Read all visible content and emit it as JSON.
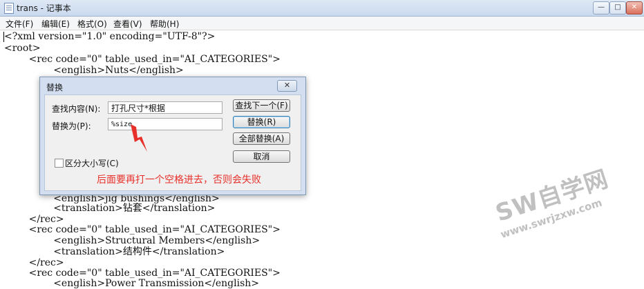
{
  "window": {
    "title": "trans - 记事本",
    "min_glyph": "—",
    "max_glyph": "□",
    "close_glyph": "✕"
  },
  "menu": [
    {
      "label": "文件(F)"
    },
    {
      "label": "编辑(E)"
    },
    {
      "label": "格式(O)"
    },
    {
      "label": "查看(V)"
    },
    {
      "label": "帮助(H)"
    }
  ],
  "editor": {
    "lines": [
      "<?xml version=\"1.0\" encoding=\"UTF-8\"?>",
      "<root>",
      "        <rec code=\"0\" table_used_in=\"AI_CATEGORIES\">",
      "                <english>Nuts</english>",
      "                <english>jig bushings</english>",
      "                <translation>钻套</translation>",
      "        </rec>",
      "        <rec code=\"0\" table_used_in=\"AI_CATEGORIES\">",
      "                <english>Structural Members</english>",
      "                <translation>结构件</translation>",
      "        </rec>",
      "        <rec code=\"0\" table_used_in=\"AI_CATEGORIES\">",
      "                <english>Power Transmission</english>"
    ]
  },
  "dialog": {
    "title": "替换",
    "close_glyph": "✕",
    "find_label": "查找内容(N):",
    "find_value": "打孔尺寸*根据",
    "replace_label": "替换为(P):",
    "replace_value": "%size",
    "find_next_button": "查找下一个(F)",
    "replace_button": "替换(R)",
    "replace_all_button": "全部替换(A)",
    "cancel_button": "取消",
    "match_case_label": "区分大小写(C)",
    "match_case_checked": false
  },
  "annotation": {
    "text": "后面要再打一个空格进去，否则会失败",
    "color": "#e8302a"
  },
  "watermark": {
    "brand": "SW自学网",
    "url": "www.swrjzxw.com"
  }
}
